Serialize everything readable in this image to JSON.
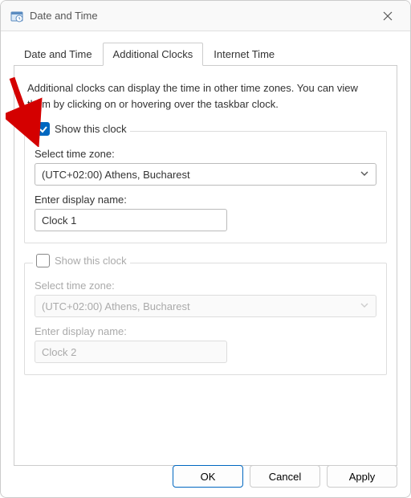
{
  "window": {
    "title": "Date and Time"
  },
  "tabs": {
    "items": [
      {
        "label": "Date and Time"
      },
      {
        "label": "Additional Clocks"
      },
      {
        "label": "Internet Time"
      }
    ]
  },
  "description": "Additional clocks can display the time in other time zones. You can view them by clicking on or hovering over the taskbar clock.",
  "clock1": {
    "show_label": "Show this clock",
    "tz_label": "Select time zone:",
    "tz_value": "(UTC+02:00) Athens, Bucharest",
    "name_label": "Enter display name:",
    "name_value": "Clock 1"
  },
  "clock2": {
    "show_label": "Show this clock",
    "tz_label": "Select time zone:",
    "tz_value": "(UTC+02:00) Athens, Bucharest",
    "name_label": "Enter display name:",
    "name_value": "Clock 2"
  },
  "buttons": {
    "ok": "OK",
    "cancel": "Cancel",
    "apply": "Apply"
  }
}
